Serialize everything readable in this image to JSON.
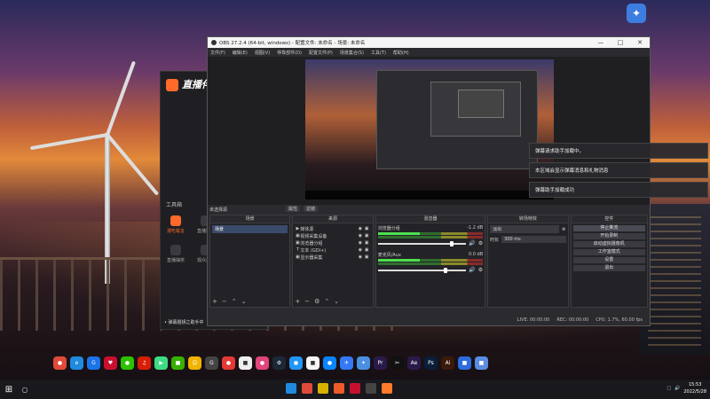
{
  "desktop": {
    "icon_label": "✦"
  },
  "assistant": {
    "title": "直播伴侣",
    "tools_label": "工具箱",
    "items": [
      {
        "label": "漫吃载言"
      },
      {
        "label": "直播贴纸"
      },
      {
        "label": "直播抽奖"
      },
      {
        "label": "观众连线"
      }
    ],
    "status": "• 弹幕题钥之助手中"
  },
  "obs": {
    "title": "OBS 27.2.4 (64-bit, windows) - 配置文件: 未命名 - 场景: 未命名",
    "menu": [
      "文件(F)",
      "编辑(E)",
      "视图(V)",
      "停靠部件(D)",
      "配置文件(P)",
      "场景集合(S)",
      "工具(T)",
      "帮助(H)"
    ],
    "no_source_selected": "未选择源",
    "props_button": "属性",
    "filters_button": "滤镜",
    "docks": {
      "scenes_title": "场景",
      "sources_title": "来源",
      "mixer_title": "混音器",
      "transitions_title": "转场特效",
      "controls_title": "控件"
    },
    "scenes": [
      "场景"
    ],
    "sources": [
      {
        "icon": "▶",
        "name": "媒体源"
      },
      {
        "icon": "▣",
        "name": "视频采集设备"
      },
      {
        "icon": "▣",
        "name": "浏览器分组"
      },
      {
        "icon": "T",
        "name": "文本 (GDI+)"
      },
      {
        "icon": "▣",
        "name": "显示器采集"
      }
    ],
    "mixer": [
      {
        "name": "浏览器分组",
        "db": "-1.2 dB",
        "level": 0.82
      },
      {
        "name": "麦克风/Aux",
        "db": "0.0 dB",
        "level": 0.75
      }
    ],
    "transitions": {
      "effect": "淡出",
      "duration_label": "时长",
      "duration": "300 ms"
    },
    "controls": [
      {
        "label": "停止推流",
        "highlight": true
      },
      {
        "label": "开始录制",
        "highlight": false
      },
      {
        "label": "启动虚拟摄像机",
        "highlight": false
      },
      {
        "label": "工作室模式",
        "highlight": false
      },
      {
        "label": "设置",
        "highlight": false
      },
      {
        "label": "退出",
        "highlight": false
      }
    ],
    "status": {
      "live_time": "LIVE: 00:00:00",
      "rec": "REC: 00:00:00",
      "cpu": "CPU: 1.7%, 60.00 fps"
    }
  },
  "notifications": [
    "弹幕请求助手加载中。",
    "本区域会显示弹幕消息和礼物消息",
    "弹幕助手加载成功"
  ],
  "app_dock": [
    {
      "name": "chrome-icon",
      "color": "#e04a3a",
      "glyph": "●"
    },
    {
      "name": "edge-icon",
      "color": "#1f8ae0",
      "glyph": "e"
    },
    {
      "name": "app-blue-icon",
      "color": "#1a73e8",
      "glyph": "G"
    },
    {
      "name": "app-red-icon",
      "color": "#c8102e",
      "glyph": "♥"
    },
    {
      "name": "wechat-icon",
      "color": "#2dc100",
      "glyph": "●"
    },
    {
      "name": "netease-icon",
      "color": "#d81e06",
      "glyph": "♫"
    },
    {
      "name": "play-icon",
      "color": "#3ddc84",
      "glyph": "▶"
    },
    {
      "name": "app-green-icon",
      "color": "#38b000",
      "glyph": "■"
    },
    {
      "name": "app-cat-icon",
      "color": "#f0b400",
      "glyph": "☺"
    },
    {
      "name": "app-g-icon",
      "color": "#444",
      "glyph": "G"
    },
    {
      "name": "app-red2-icon",
      "color": "#e53935",
      "glyph": "●"
    },
    {
      "name": "app-white-icon",
      "color": "#eee",
      "glyph": "■"
    },
    {
      "name": "app-pink-icon",
      "color": "#e0457b",
      "glyph": "●"
    },
    {
      "name": "steam-icon",
      "color": "#1b2838",
      "glyph": "⚙"
    },
    {
      "name": "app-blue2-icon",
      "color": "#2196f3",
      "glyph": "●"
    },
    {
      "name": "app-white2-icon",
      "color": "#f5f5f5",
      "glyph": "■"
    },
    {
      "name": "app-blue3-icon",
      "color": "#0a84ff",
      "glyph": "●"
    },
    {
      "name": "app-blue4-icon",
      "color": "#3478f6",
      "glyph": "✈"
    },
    {
      "name": "app-bird-icon",
      "color": "#4a90e2",
      "glyph": "✦"
    },
    {
      "name": "premiere-icon",
      "color": "#2a1a4a",
      "glyph": "Pr"
    },
    {
      "name": "capcut-icon",
      "color": "#111",
      "glyph": "✂"
    },
    {
      "name": "after-effects-icon",
      "color": "#2a1a4a",
      "glyph": "Ae"
    },
    {
      "name": "photoshop-icon",
      "color": "#0a1e3a",
      "glyph": "Ps"
    },
    {
      "name": "illustrator-icon",
      "color": "#3a1a0a",
      "glyph": "Ai"
    },
    {
      "name": "app-blue5-icon",
      "color": "#2d6cdf",
      "glyph": "■"
    },
    {
      "name": "app-blue6-icon",
      "color": "#5a8de0",
      "glyph": "■"
    }
  ],
  "taskbar": {
    "time": "15:53",
    "date": "2022/5/28",
    "apps": [
      "#1f8ae0",
      "#e04a3a",
      "#d8b000",
      "#f05a28",
      "#c8102e",
      "#444",
      "#ff7a2b"
    ]
  }
}
